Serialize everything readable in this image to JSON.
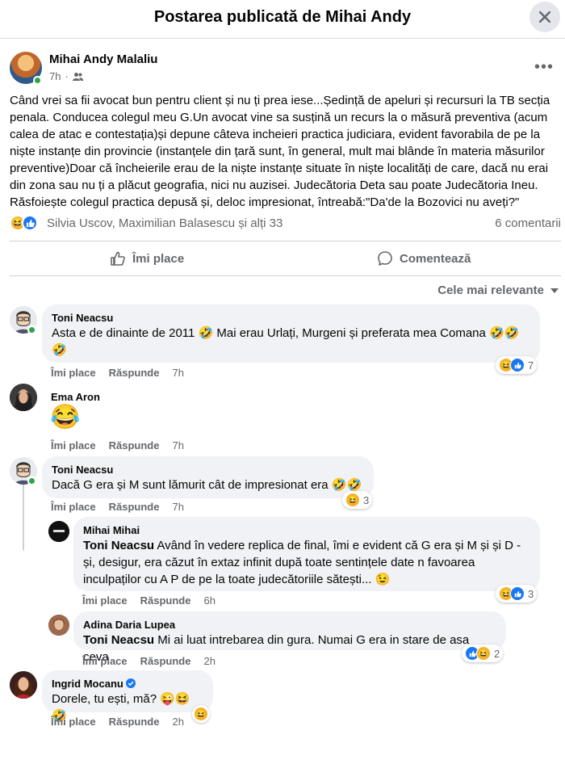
{
  "header": {
    "title": "Postarea publicată de Mihai Andy"
  },
  "post": {
    "author": "Mihai Andy Malaliu",
    "time": "7h",
    "text": "Când vrei sa fii avocat bun pentru client și nu ți prea iese...Ședință de apeluri și recursuri la TB secția penala. Conducea colegul meu G.Un avocat vine sa susțină un recurs la  o măsură preventiva (acum calea de atac e contestația)și depune câteva incheieri practica judiciara, evident favorabila de pe la niște instanțe din provincie (instanțele din țară sunt, în general, mult mai blânde în materia măsurilor preventive)Doar că încheierile erau de la niște instanțe situate în niște localități de care, dacă nu erai din zona sau nu ți  a plăcut geografia, nici nu auzisei. Judecătoria Deta sau poate Judecătoria Ineu. Răsfoiește colegul practica depusă și, deloc impresionat, întreabă:\"Da'de la Bozovici nu aveți?\"",
    "reactors": "Silvia Uscov, Maximilian Balasescu și alți 33",
    "comments_count": "6 comentarii"
  },
  "actions": {
    "like": "Îmi place",
    "comment": "Comentează"
  },
  "sort_label": "Cele mai relevante",
  "comment_actions": {
    "like": "Îmi place",
    "reply": "Răspunde"
  },
  "comments": [
    {
      "name": "Toni Neacsu",
      "text": "Asta e de dinainte de 2011 🤣 Mai erau Urlați, Murgeni și preferata mea Comana 🤣🤣",
      "text2": "🤣",
      "time": "7h",
      "reactions": "7"
    },
    {
      "name": "Ema Aron",
      "text": "😂",
      "time": "7h"
    },
    {
      "name": "Toni Neacsu",
      "text": "Dacă G era și M sunt lămurit cât de impresionat era 🤣🤣",
      "time": "7h",
      "reactions": "3"
    },
    {
      "name": "Mihai Mihai",
      "mention": "Toni Neacsu",
      "text": " Având în vedere replica de final, îmi e evident că G era și M și și D - și, desigur, era căzut în extaz infinit după toate sentințele date n favoarea inculpaților cu A P de pe la toate judecătoriile sătești... 😉",
      "time": "6h",
      "reactions": "3"
    },
    {
      "name": "Adina Daria Lupea",
      "mention": "Toni Neacsu",
      "text": " Mi ai luat intrebarea din gura. Numai G era in stare de asa ceva",
      "time": "2h",
      "reactions": "2"
    },
    {
      "name": "Ingrid Mocanu",
      "text": "Dorele, tu ești, mă? 😜😆🤣",
      "time": "2h"
    }
  ]
}
